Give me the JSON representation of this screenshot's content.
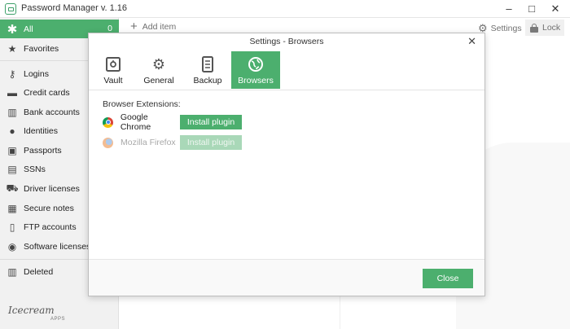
{
  "window": {
    "title": "Password Manager v. 1.16",
    "minimize": "–",
    "maximize": "□",
    "close": "✕"
  },
  "sidebar": {
    "items": [
      {
        "label": "All",
        "icon": "asterisk-icon",
        "count": "0",
        "active": true
      },
      {
        "label": "Favorites",
        "icon": "star-icon"
      },
      {
        "label": "Logins",
        "icon": "key-icon"
      },
      {
        "label": "Credit cards",
        "icon": "credit-card-icon"
      },
      {
        "label": "Bank accounts",
        "icon": "bank-icon"
      },
      {
        "label": "Identities",
        "icon": "person-icon"
      },
      {
        "label": "Passports",
        "icon": "passport-icon"
      },
      {
        "label": "SSNs",
        "icon": "ssn-icon"
      },
      {
        "label": "Driver licenses",
        "icon": "car-icon"
      },
      {
        "label": "Secure notes",
        "icon": "note-icon"
      },
      {
        "label": "FTP accounts",
        "icon": "ftp-icon"
      },
      {
        "label": "Software licenses",
        "icon": "software-icon"
      },
      {
        "label": "Deleted",
        "icon": "trash-icon"
      }
    ],
    "brand": "Icecream",
    "brand_sub": "APPS"
  },
  "toolbar": {
    "add_label": "Add item",
    "settings_label": "Settings",
    "lock_label": "Lock"
  },
  "background": {
    "letter": "d"
  },
  "dialog": {
    "title": "Settings - Browsers",
    "close_glyph": "✕",
    "tabs": [
      {
        "label": "Vault",
        "icon": "vault-icon"
      },
      {
        "label": "General",
        "icon": "gear-icon"
      },
      {
        "label": "Backup",
        "icon": "backup-icon"
      },
      {
        "label": "Browsers",
        "icon": "globe-icon",
        "active": true
      }
    ],
    "extensions_heading": "Browser Extensions:",
    "browsers": [
      {
        "name": "Google Chrome",
        "button": "Install plugin",
        "enabled": true
      },
      {
        "name": "Mozilla Firefox",
        "button": "Install plugin",
        "enabled": false
      }
    ],
    "close_button": "Close"
  },
  "colors": {
    "accent": "#4caf6e",
    "accent_disabled": "#a9d8b8",
    "sidebar_bg": "#f1f1f1"
  }
}
